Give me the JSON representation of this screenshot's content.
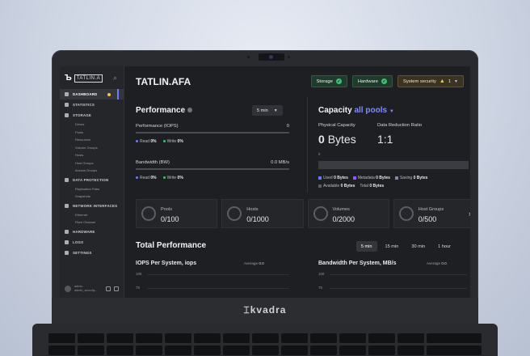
{
  "device": {
    "brand": "⌶kvadra"
  },
  "sidebar": {
    "logo_box": "TATLIN.A",
    "items": [
      {
        "label": "Dashboard",
        "active": true
      },
      {
        "label": "Statistics"
      },
      {
        "label": "Storage"
      },
      {
        "label": "Data protection"
      },
      {
        "label": "Network interfaces"
      },
      {
        "label": "Hardware"
      },
      {
        "label": "Logs"
      },
      {
        "label": "Settings"
      }
    ],
    "storage_sub": [
      "Drives",
      "Pools",
      "Resources",
      "Volume Groups",
      "Hosts",
      "Host Groups",
      "Access Groups"
    ],
    "protection_sub": [
      "Replication Pairs",
      "Snapshots"
    ],
    "network_sub": [
      "Ethernet",
      "Fibre Channel"
    ],
    "user_line1": "admin",
    "user_line2": "admin_security..."
  },
  "header": {
    "title": "TATLIN.AFA",
    "storage": "Storage",
    "hardware": "Hardware",
    "security": "System security",
    "security_count": "1"
  },
  "performance": {
    "title": "Performance",
    "interval": "5 min",
    "iops_label": "Performance (IOPS)",
    "iops_value": "0",
    "read_label": "Read",
    "read_value": "0%",
    "write_label": "Write",
    "write_value": "0%",
    "bw_label": "Bandwidth (BW)",
    "bw_value": "0.0 MB/s",
    "bw_read_value": "0%",
    "bw_write_value": "0%"
  },
  "capacity": {
    "title": "Capacity",
    "pool": "all pools",
    "physical_label": "Physical Capacity",
    "physical_num": "0",
    "physical_unit": "Bytes",
    "drr_label": "Data Reduction Ratio",
    "drr_value": "1:1",
    "bar_zero": "0",
    "used": "Used",
    "used_val": "0 Bytes",
    "metadata": "Metadata",
    "metadata_val": "0 Bytes",
    "saving": "Saving",
    "saving_val": "0 Bytes",
    "available": "Available",
    "available_val": "0 Bytes",
    "total": "Total",
    "total_val": "0 Bytes"
  },
  "counters": [
    {
      "label": "Pools",
      "value": "0/100"
    },
    {
      "label": "Hosts",
      "value": "0/1000"
    },
    {
      "label": "Volumes",
      "value": "0/2000"
    },
    {
      "label": "Host Groups",
      "value": "0/500"
    }
  ],
  "total_performance": {
    "title": "Total Performance",
    "tabs": [
      "5 min",
      "15 min",
      "30 min",
      "1 hour"
    ],
    "iops_title": "IOPS Per System, iops",
    "iops_avg_label": "Average",
    "iops_avg": "0.0",
    "bw_title": "Bandwidth Per System, MB/s",
    "bw_avg_label": "Average",
    "bw_avg": "0.0",
    "tick_100": "100",
    "tick_75": "75"
  },
  "colors": {
    "accent": "#7f8cff",
    "ok": "#3cc173",
    "warn": "#f5c542",
    "read_dot": "#6c7cff",
    "write_dot": "#3cc173",
    "used": "#5b7cff",
    "metadata": "#8a5cff",
    "saving": "#7f8aa3",
    "available": "#5a5d64"
  }
}
